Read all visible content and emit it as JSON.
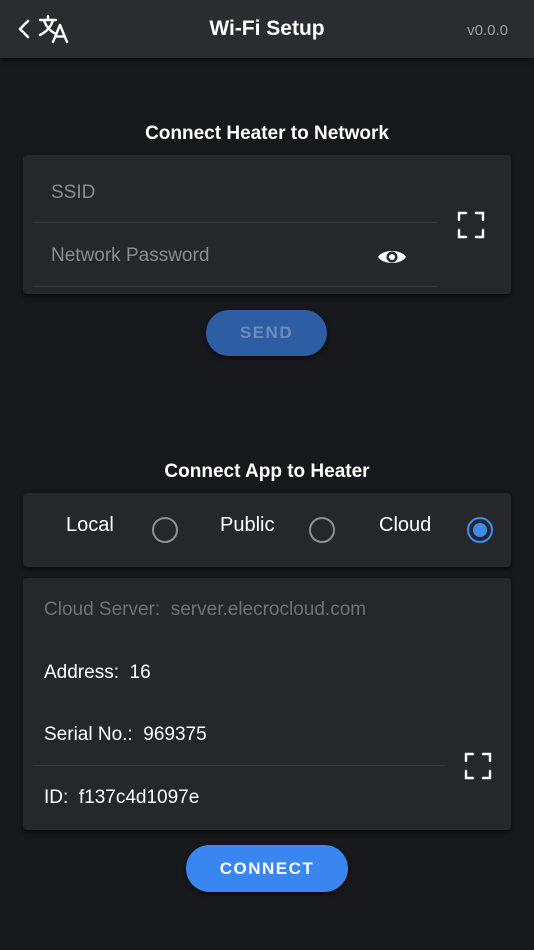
{
  "header": {
    "title": "Wi-Fi Setup",
    "version": "v0.0.0",
    "back_icon": "chevron-left-icon",
    "translate_icon": "translate-icon"
  },
  "network": {
    "section_title": "Connect Heater to Network",
    "ssid_placeholder": "SSID",
    "password_placeholder": "Network Password",
    "send_label": "SEND"
  },
  "app": {
    "section_title": "Connect App to Heater",
    "modes": [
      {
        "label": "Local",
        "checked": false
      },
      {
        "label": "Public",
        "checked": false
      },
      {
        "label": "Cloud",
        "checked": true
      }
    ],
    "cloud_server_label": "Cloud Server:",
    "cloud_server_value": "server.elecrocloud.com",
    "address_label": "Address:",
    "address_value": "16",
    "serial_label": "Serial No.:",
    "serial_value": "969375",
    "id_label": "ID:",
    "id_value": "f137c4d1097e",
    "connect_label": "CONNECT"
  },
  "colors": {
    "background": "#17181b",
    "card": "#25272b",
    "accent": "#3d8cf2",
    "send_button": "#2d5ea3"
  }
}
